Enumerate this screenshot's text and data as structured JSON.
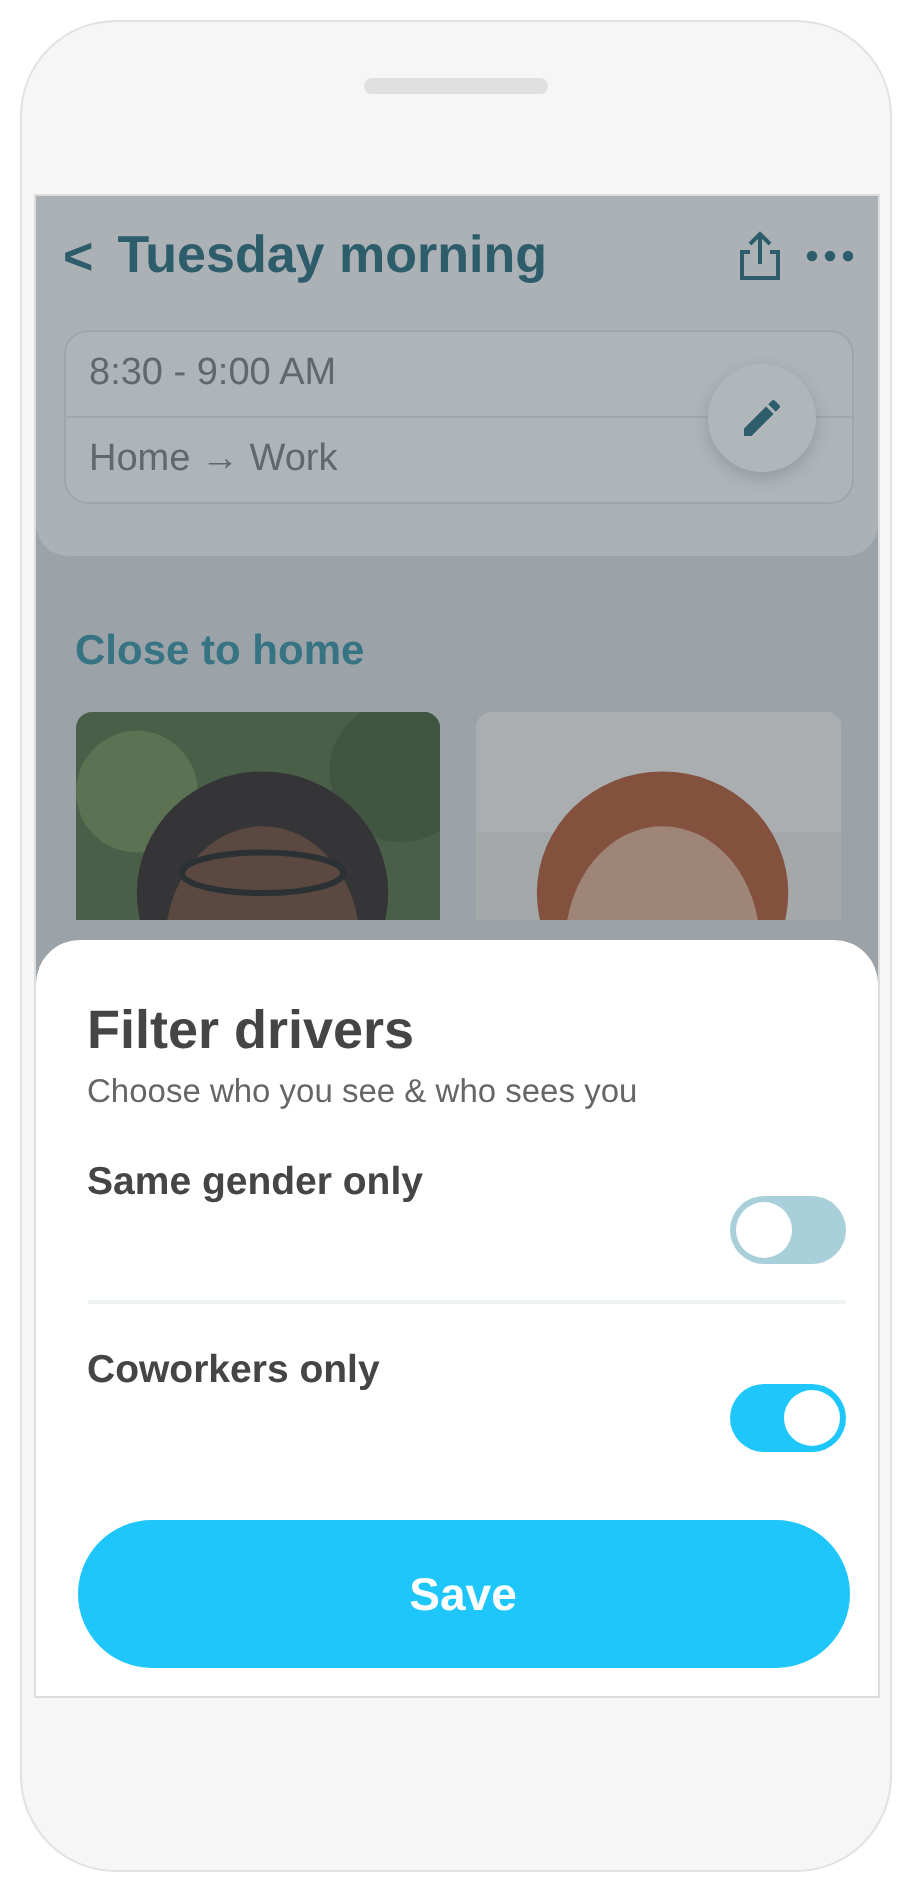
{
  "header": {
    "back": "<",
    "title": "Tuesday morning"
  },
  "trip": {
    "time": "8:30 - 9:00 AM",
    "route": "Home → Work"
  },
  "section": {
    "title": "Close to home"
  },
  "sheet": {
    "title": "Filter drivers",
    "subtitle": "Choose who you see & who sees you",
    "options": [
      {
        "label": "Same gender only",
        "on": false
      },
      {
        "label": "Coworkers only",
        "on": true
      }
    ],
    "save": "Save"
  }
}
